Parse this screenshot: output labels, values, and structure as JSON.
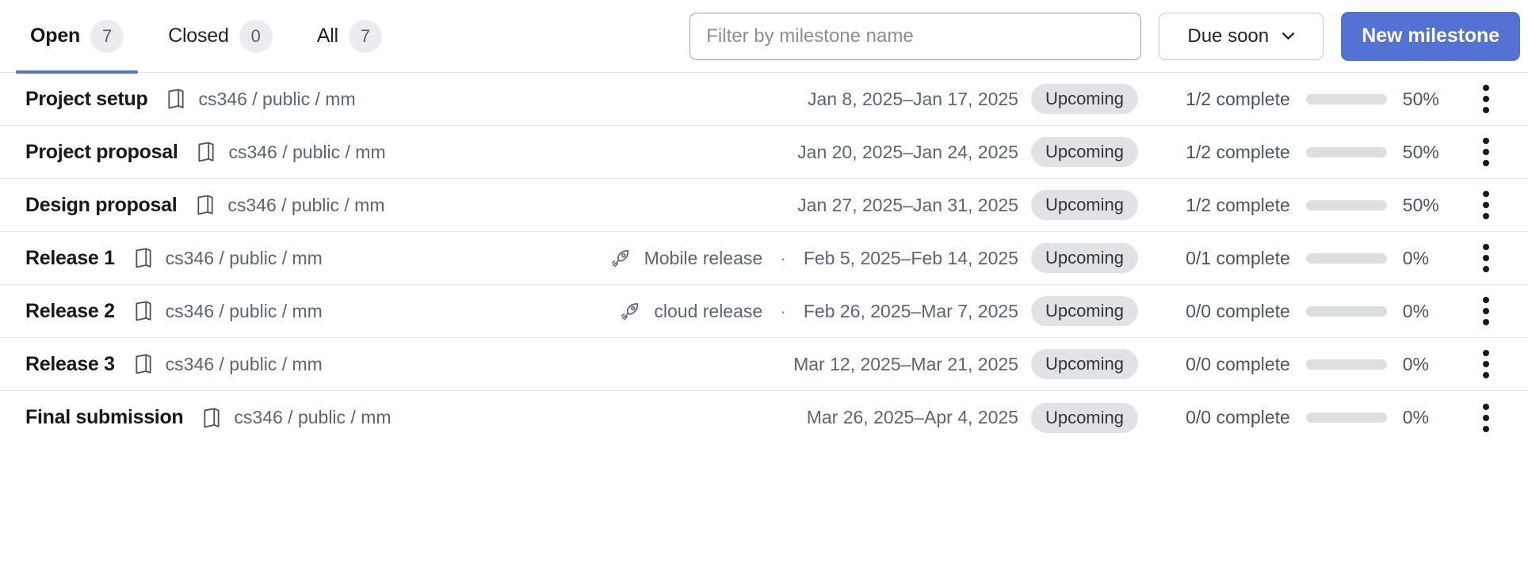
{
  "header": {
    "tabs": [
      {
        "label": "Open",
        "count": "7",
        "active": true,
        "name": "tab-open"
      },
      {
        "label": "Closed",
        "count": "0",
        "active": false,
        "name": "tab-closed"
      },
      {
        "label": "All",
        "count": "7",
        "active": false,
        "name": "tab-all"
      }
    ],
    "filter": {
      "placeholder": "Filter by milestone name",
      "value": ""
    },
    "sort": {
      "label": "Due soon",
      "icon": "chevron-down-icon"
    },
    "new_button": {
      "label": "New milestone"
    }
  },
  "colors": {
    "accent": "#5472d3",
    "badge_bg": "#e0e2e5",
    "track": "#dcdee1",
    "text": "#16191d",
    "muted": "#5c6570"
  },
  "milestones": [
    {
      "name": "Project setup",
      "repo_icon": "repo-icon",
      "repo": "cs346 / public / mm",
      "release": "",
      "release_icon": "",
      "separator": "",
      "dates": "Jan 8, 2025–Jan 17, 2025",
      "status": "Upcoming",
      "complete": "1/2 complete",
      "percent": "50%",
      "percent_value": 50
    },
    {
      "name": "Project proposal",
      "repo_icon": "repo-icon",
      "repo": "cs346 / public / mm",
      "release": "",
      "release_icon": "",
      "separator": "",
      "dates": "Jan 20, 2025–Jan 24, 2025",
      "status": "Upcoming",
      "complete": "1/2 complete",
      "percent": "50%",
      "percent_value": 50
    },
    {
      "name": "Design proposal",
      "repo_icon": "repo-icon",
      "repo": "cs346 / public / mm",
      "release": "",
      "release_icon": "",
      "separator": "",
      "dates": "Jan 27, 2025–Jan 31, 2025",
      "status": "Upcoming",
      "complete": "1/2 complete",
      "percent": "50%",
      "percent_value": 50
    },
    {
      "name": "Release 1",
      "repo_icon": "repo-icon",
      "repo": "cs346 / public / mm",
      "release": "Mobile release",
      "release_icon": "rocket-icon",
      "separator": "·",
      "dates": "Feb 5, 2025–Feb 14, 2025",
      "status": "Upcoming",
      "complete": "0/1 complete",
      "percent": "0%",
      "percent_value": 0
    },
    {
      "name": "Release 2",
      "repo_icon": "repo-icon",
      "repo": "cs346 / public / mm",
      "release": "cloud release",
      "release_icon": "rocket-icon",
      "separator": "·",
      "dates": "Feb 26, 2025–Mar 7, 2025",
      "status": "Upcoming",
      "complete": "0/0 complete",
      "percent": "0%",
      "percent_value": 0
    },
    {
      "name": "Release 3",
      "repo_icon": "repo-icon",
      "repo": "cs346 / public / mm",
      "release": "",
      "release_icon": "",
      "separator": "",
      "dates": "Mar 12, 2025–Mar 21, 2025",
      "status": "Upcoming",
      "complete": "0/0 complete",
      "percent": "0%",
      "percent_value": 0
    },
    {
      "name": "Final submission",
      "repo_icon": "repo-icon",
      "repo": "cs346 / public / mm",
      "release": "",
      "release_icon": "",
      "separator": "",
      "dates": "Mar 26, 2025–Apr 4, 2025",
      "status": "Upcoming",
      "complete": "0/0 complete",
      "percent": "0%",
      "percent_value": 0
    }
  ]
}
